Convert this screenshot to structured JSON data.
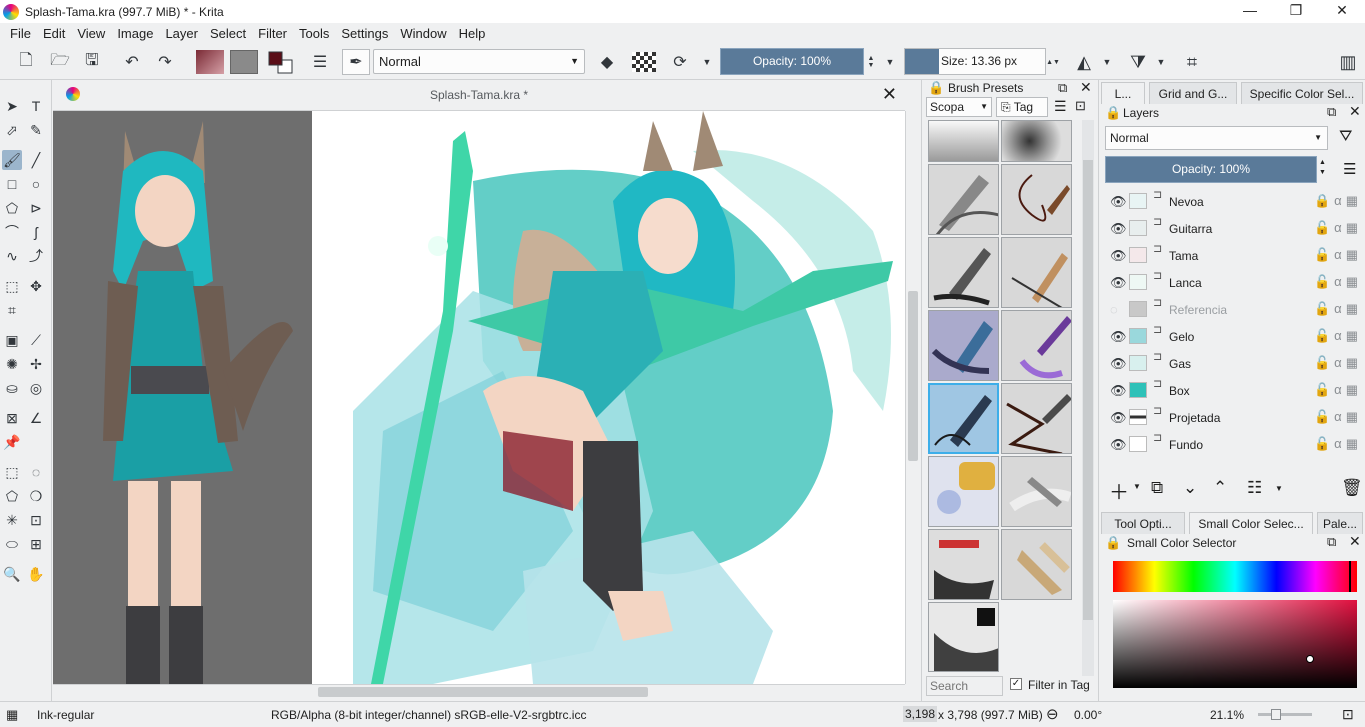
{
  "window": {
    "title": "Splash-Tama.kra (997.7 MiB)  * - Krita",
    "minimize": "—",
    "restore": "❐",
    "close": "✕"
  },
  "menu": [
    "File",
    "Edit",
    "View",
    "Image",
    "Layer",
    "Select",
    "Filter",
    "Tools",
    "Settings",
    "Window",
    "Help"
  ],
  "toolbar": {
    "blend_mode": "Normal",
    "opacity_label": "Opacity: 100%",
    "size_label": "Size: 13.36 px",
    "foreground_color": "#5a0d17",
    "background_color": "#ffffff"
  },
  "document": {
    "tab_title": "Splash-Tama.kra *",
    "close": "✕"
  },
  "brush_presets": {
    "title": "Brush Presets",
    "scope_label": "Scopa",
    "tag_label": "Tag",
    "search_placeholder": "Search",
    "filter_in_tag": "Filter in Tag",
    "filter_checked": true
  },
  "right_tabs": {
    "top": [
      "L...",
      "Grid and G...",
      "Specific Color Sel..."
    ],
    "bottom": [
      "Tool Opti...",
      "Small Color Selec...",
      "Pale..."
    ]
  },
  "layers": {
    "title": "Layers",
    "blend_mode": "Normal",
    "opacity_label": "Opacity:  100%",
    "items": [
      {
        "name": "Nevoa",
        "visible": true,
        "locked": true
      },
      {
        "name": "Guitarra",
        "visible": true,
        "locked": false
      },
      {
        "name": "Tama",
        "visible": true,
        "locked": false
      },
      {
        "name": "Lanca",
        "visible": true,
        "locked": false
      },
      {
        "name": "Referencia",
        "visible": false,
        "locked": false
      },
      {
        "name": "Gelo",
        "visible": true,
        "locked": false
      },
      {
        "name": "Gas",
        "visible": true,
        "locked": false
      },
      {
        "name": "Box",
        "visible": true,
        "locked": false
      },
      {
        "name": "Projetada",
        "visible": true,
        "locked": false
      },
      {
        "name": "Fundo",
        "visible": true,
        "locked": false
      }
    ]
  },
  "color_selector": {
    "title": "Small Color Selector",
    "hue_color": "#e0103f"
  },
  "status": {
    "brush_name": "Ink-regular",
    "color_info": "RGB/Alpha (8-bit integer/channel)  sRGB-elle-V2-srgbtrc.icc",
    "dimensions_highlight": "3,198",
    "dimensions_rest": " x 3,798 (997.7 MiB)",
    "rotation": "0.00°",
    "zoom": "21.1%"
  }
}
